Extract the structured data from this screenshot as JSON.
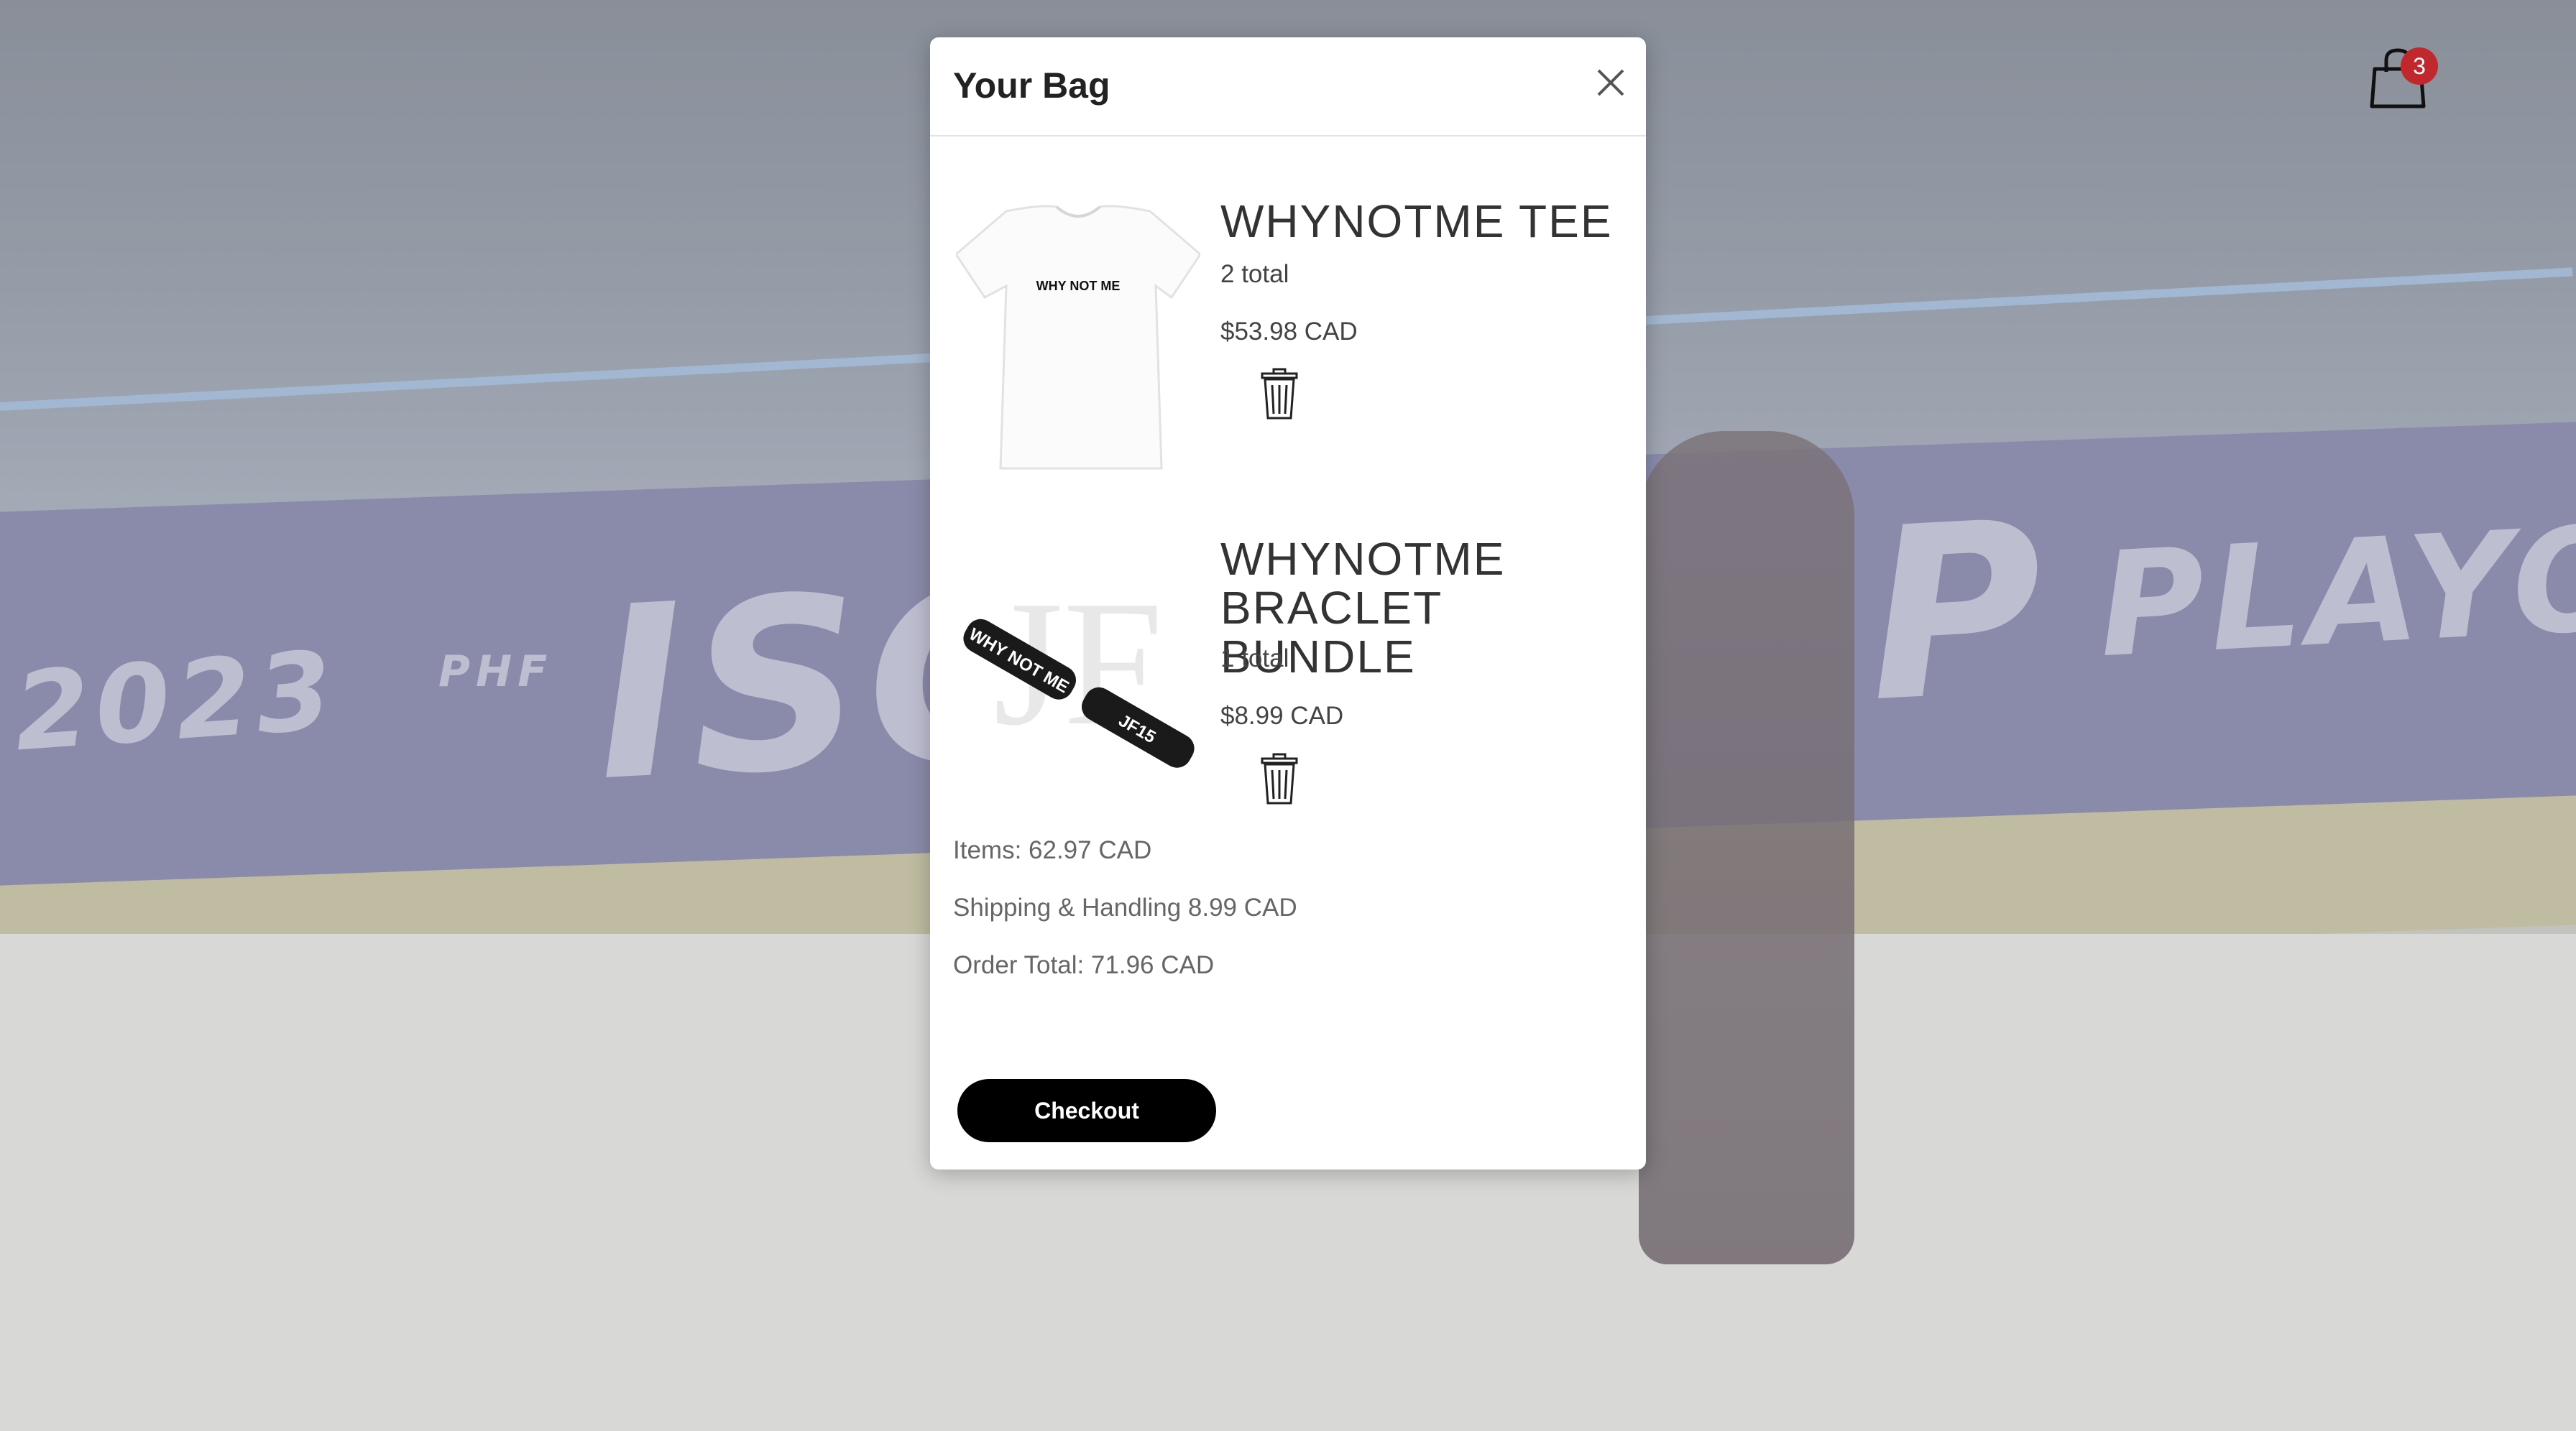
{
  "background": {
    "banner_year": "2023",
    "banner_isc": "ISC",
    "banner_p": "P",
    "banner_playoff": "PLAYOFF",
    "banner_phf": "PHF"
  },
  "header": {
    "bag_icon": "shopping-bag-icon",
    "bag_count": "3"
  },
  "modal": {
    "title": "Your Bag",
    "close_icon": "close-icon",
    "items": [
      {
        "name": "WHYNOTME TEE",
        "qty": "2 total",
        "price": "$53.98 CAD",
        "image_text": "WHY NOT ME",
        "delete_icon": "trash-icon"
      },
      {
        "name": "WHYNOTME BRACLET BUNDLE",
        "qty": "1 total",
        "price": "$8.99 CAD",
        "image_text_1": "WHY NOT ME",
        "image_text_2": "JF15",
        "delete_icon": "trash-icon"
      }
    ],
    "summary": {
      "items": "Items: 62.97 CAD",
      "shipping": "Shipping & Handling 8.99 CAD",
      "total": "Order Total: 71.96 CAD"
    },
    "checkout_label": "Checkout"
  },
  "colors": {
    "badge": "#c0282d",
    "checkout_bg": "#000000",
    "modal_bg": "#ffffff"
  }
}
